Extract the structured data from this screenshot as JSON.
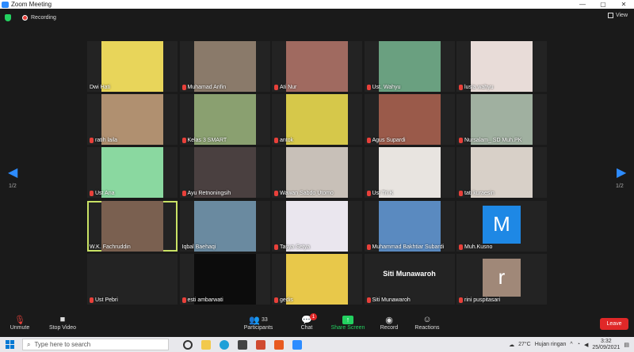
{
  "window": {
    "title": "Zoom Meeting",
    "min": "—",
    "max": "▢",
    "close": "✕"
  },
  "topbar": {
    "recording": "Recording",
    "view": "View"
  },
  "nav": {
    "left_page": "1/2",
    "right_page": "1/2"
  },
  "participants": [
    {
      "name": "Dwi Hati",
      "bg": "#e8d55a"
    },
    {
      "name": "Muhamad Arifin",
      "bg": "#8a7a6a"
    },
    {
      "name": "Ati Nur",
      "bg": "#a06a60"
    },
    {
      "name": "Ust. Wahyu",
      "bg": "#6aa080"
    },
    {
      "name": "lusia wahyu",
      "bg": "#e8dcd8"
    },
    {
      "name": "ratih laila",
      "bg": "#b09070"
    },
    {
      "name": "Kelas 3 SMART",
      "bg": "#8aa070"
    },
    {
      "name": "antok",
      "bg": "#d6c84a"
    },
    {
      "name": "Agus Supardi",
      "bg": "#9a5a4a"
    },
    {
      "name": "Nursalam_ SD Muh.PK",
      "bg": "#a0b0a0"
    },
    {
      "name": "Ust Ana",
      "bg": "#8ad8a0"
    },
    {
      "name": "Ayu Retnoningsih",
      "bg": "#4a4040"
    },
    {
      "name": "Wawan Sabdo Utomo",
      "bg": "#c8c0b8"
    },
    {
      "name": "Ust Tri K",
      "bg": "#e8e4e0"
    },
    {
      "name": "tati kuraesin",
      "bg": "#d8d0c8"
    },
    {
      "name": "W.K. Fachruddin",
      "bg": "#7a6050"
    },
    {
      "name": "Iqbal Baehaqi",
      "bg": "#6a8aa0"
    },
    {
      "name": "Tasya Setya",
      "bg": "#eae6ee"
    },
    {
      "name": "Muhammad Bakhtiar Subardi",
      "bg": "#5a8ac0"
    },
    {
      "name": "Muh.Kusno",
      "bg": "#232323",
      "letter": "M",
      "letter_bg": "#1e88e5"
    },
    {
      "name": "Ust Pebri",
      "bg": "#232323"
    },
    {
      "name": "esti ambarwati",
      "bg": "#0c0c0c"
    },
    {
      "name": "gedis",
      "bg": "#e8c84a"
    },
    {
      "name": "Siti Munawaroh",
      "bg": "#232323",
      "card": "Siti Munawaroh"
    },
    {
      "name": "rini puspitasari",
      "bg": "#232323",
      "letter": "r",
      "letter_bg": "#a08878"
    }
  ],
  "toolbar": {
    "unmute": "Unmute",
    "stop_video": "Stop Video",
    "participants": "Participants",
    "participant_count": "33",
    "chat": "Chat",
    "chat_badge": "1",
    "share": "Share Screen",
    "record": "Record",
    "reactions": "Reactions",
    "leave": "Leave"
  },
  "taskbar": {
    "search_placeholder": "Type here to search",
    "temperature": "27°C",
    "weather": "Hujan ringan",
    "time": "3:32",
    "date": "25/09/2021"
  },
  "colors": {
    "accent": "#2d8cff",
    "share_green": "#23d160",
    "leave_red": "#e02828",
    "active_speaker": "#c9e265"
  }
}
